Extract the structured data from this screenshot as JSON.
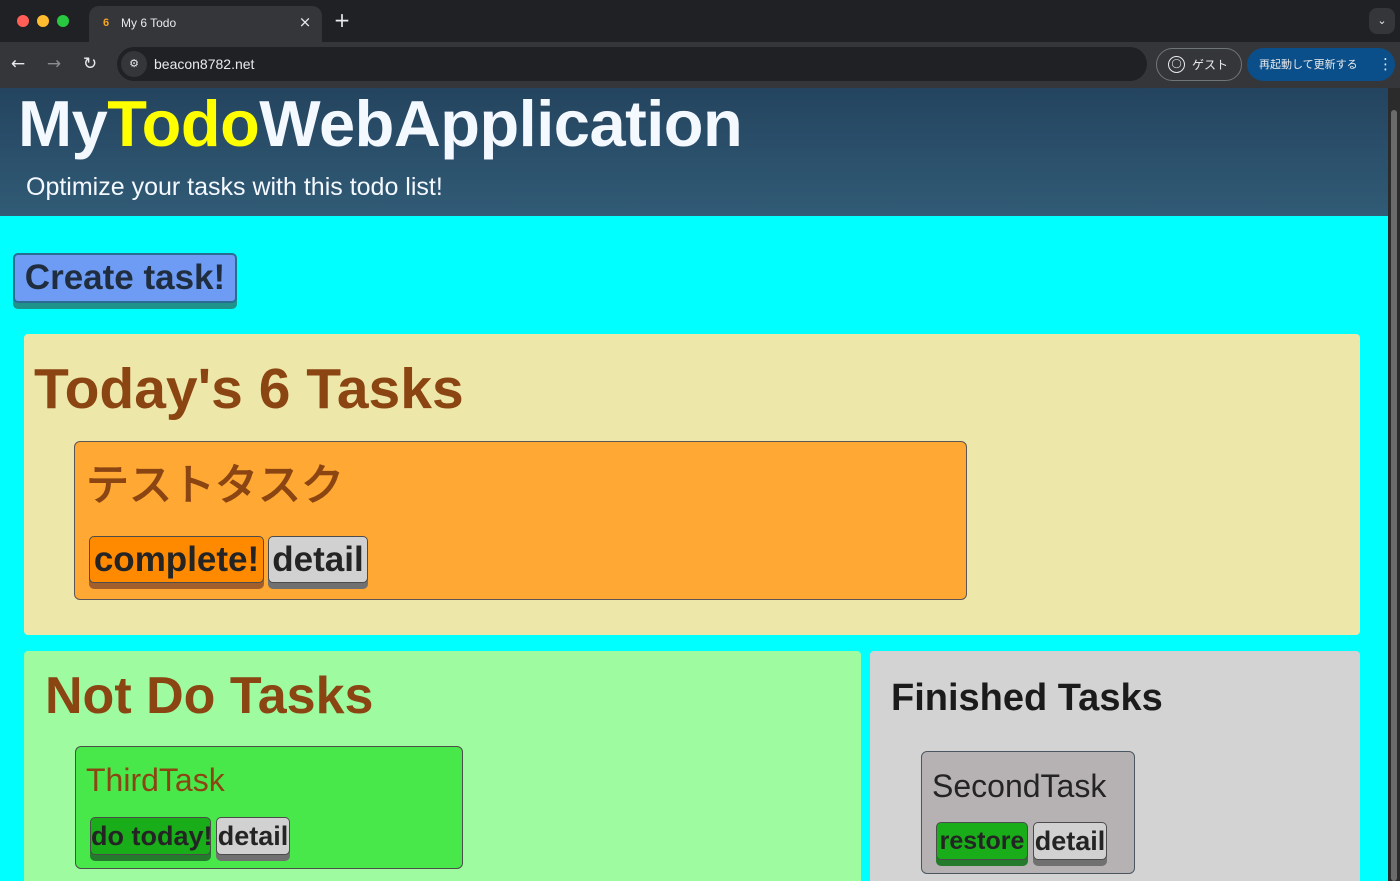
{
  "browser": {
    "tab_title": "My 6 Todo",
    "tab_favicon": "6",
    "url": "beacon8782.net",
    "guest_label": "ゲスト",
    "relaunch_label": "再起動して更新する",
    "icons": {
      "close": "×",
      "new_tab": "+",
      "tab_menu": "⌄",
      "back": "←",
      "forward": "→",
      "reload": "↻",
      "site_info": "⚙",
      "guest": "◯",
      "more": "⋮"
    }
  },
  "header": {
    "title_part_1": "My",
    "title_part_2": "Todo",
    "title_part_3": "WebApplication",
    "subtitle": "Optimize your tasks with this todo list!"
  },
  "actions": {
    "create_label": "Create task!"
  },
  "today": {
    "title": "Today's 6 Tasks",
    "tasks": [
      {
        "title": "テストタスク",
        "primary_action": "complete!",
        "detail_action": "detail"
      }
    ]
  },
  "not_do": {
    "title": "Not Do Tasks",
    "tasks": [
      {
        "title": "ThirdTask",
        "primary_action": "do today!",
        "detail_action": "detail"
      }
    ]
  },
  "finished": {
    "title": "Finished Tasks",
    "tasks": [
      {
        "title": "SecondTask",
        "primary_action": "restore",
        "detail_action": "detail"
      }
    ]
  },
  "colors": {
    "page_background": "#00ffff",
    "header_accent": "#ffff00",
    "task_title": "#8b4513",
    "today_section": "#eee7aa",
    "today_task": "#ffa833",
    "not_do_section": "#9efba0",
    "not_do_task": "#48e84b",
    "finished_section": "#d3d3d3",
    "finished_task": "#b6b2b3"
  }
}
